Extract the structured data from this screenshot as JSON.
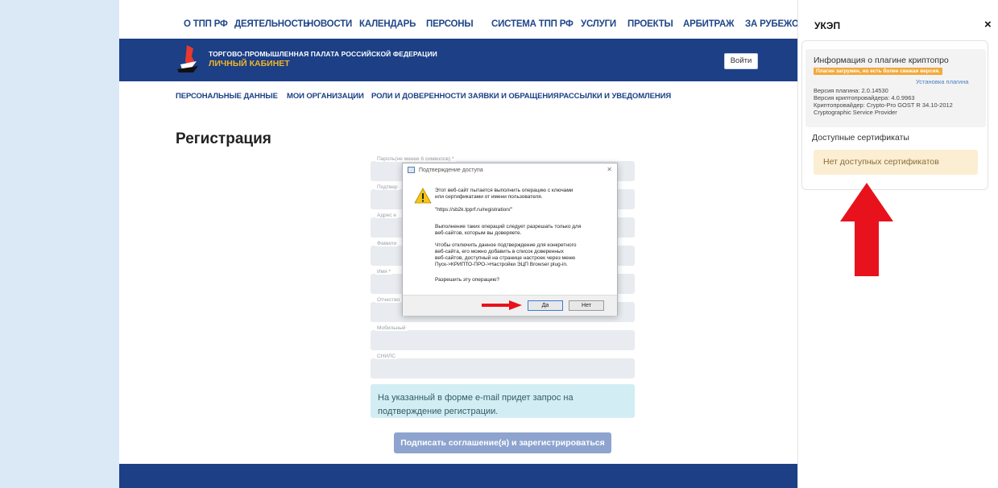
{
  "top_nav": [
    "О ТПП РФ",
    "ДЕЯТЕЛЬНОСТЬ",
    "НОВОСТИ",
    "КАЛЕНДАРЬ",
    "ПЕРСОНЫ",
    "СИСТЕМА ТПП РФ",
    "УСЛУГИ",
    "ПРОЕКТЫ",
    "АРБИТРАЖ",
    "ЗА РУБЕЖОМ"
  ],
  "header": {
    "title": "ТОРГОВО-ПРОМЫШЛЕННАЯ ПАЛАТА РОССИЙСКОЙ ФЕДЕРАЦИИ",
    "subtitle": "ЛИЧНЫЙ КАБИНЕТ",
    "login_label": "Войти"
  },
  "sub_nav": [
    "ПЕРСОНАЛЬНЫЕ ДАННЫЕ",
    "МОИ ОРГАНИЗАЦИИ",
    "РОЛИ И ДОВЕРЕННОСТИ",
    "ЗАЯВКИ И ОБРАЩЕНИЯ",
    "РАССЫЛКИ И УВЕДОМЛЕНИЯ"
  ],
  "page_title": "Регистрация",
  "form": {
    "fields": [
      "Пароль(не менее 6 символов) *",
      "Подтвер",
      "Адрес e",
      "Фамили",
      "Имя *",
      "Отчество",
      "Мобильный",
      "СНИЛС"
    ],
    "info": "На указанный в форме e-mail придет запрос на подтверждение регистрации.",
    "submit_label": "Подписать соглашение(я) и зарегистрироваться"
  },
  "dialog": {
    "title": "Подтверждение доступа",
    "line1": "Этот веб-сайт пытается выполнить операцию с ключами",
    "line2": "или сертификатами от имени пользователя.",
    "url": "\"https://sb2k.tpprf.ru/registration/\"",
    "line3": "Выполнение таких операций следует разрешать только для",
    "line4": "веб-сайтов, которым вы доверяете.",
    "line5": "Чтобы отключить данное подтверждение для конкретного",
    "line6": "веб-сайта, его можно добавить в список доверенных",
    "line7": "веб-сайтов, доступный на странице настроек через меню",
    "line8": "Пуск->КРИПТО-ПРО->Настройки ЭЦП Browser plug-in.",
    "question": "Разрешить эту операцию?",
    "yes_label": "Да",
    "no_label": "Нет"
  },
  "panel": {
    "title": "УКЭП",
    "close": "×",
    "plugin_info_title": "Информация о плагине криптопро",
    "badge": "Плагин загружен, но есть более свежая версия.",
    "install_link": "Установка плагина",
    "plugin_version": "Версия плагина: 2.0.14530",
    "provider_version": "Версия криптопровайдера: 4.0.9963",
    "provider": "Криптопровайдер: Crypto-Pro GOST R 34.10-2012",
    "provider2": "Cryptographic Service Provider",
    "certs_title": "Доступные сертификаты",
    "no_certs": "Нет доступных сертификатов"
  },
  "colors": {
    "brand": "#1c3f86",
    "accent": "#f0b429",
    "annotation": "#e8121c"
  }
}
